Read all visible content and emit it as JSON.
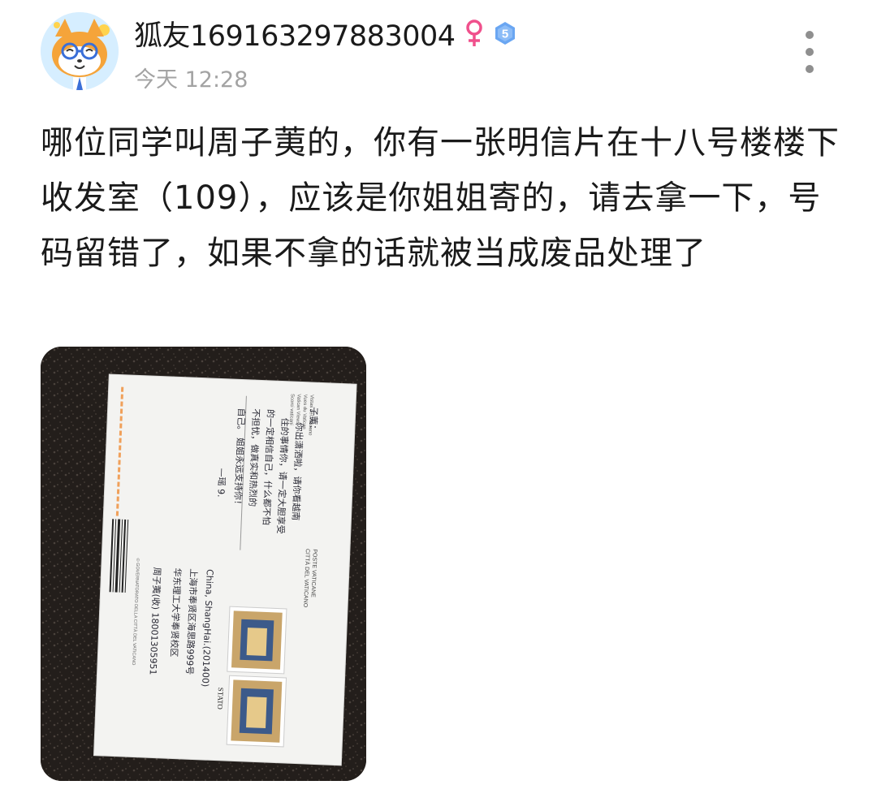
{
  "user": {
    "name": "狐友169163297883004",
    "gender": "female",
    "gender_symbol": "♀",
    "gender_color": "#f0508c",
    "level": "5",
    "level_color": "#6aa6f2"
  },
  "post": {
    "time": "今天 12:28",
    "text": "哪位同学叫周子荑的，你有一张明信片在十八号楼楼下收发室（109），应该是你姐姐寄的，请去拿一下，号码留错了，如果不拿的话就被当成废品处理了"
  },
  "photo": {
    "description_icon": "postcard-photo",
    "postcard": {
      "header_lines": [
        "Scorci vaticani",
        "Vatican Views",
        "Vues du Vatican",
        "Vistas del Vaticano"
      ],
      "handwritten_lines": [
        "子荑：",
        "你出潇洒啦，请你看越南",
        "住的事情你，请一定大胆享受",
        "的一定相信自己，什么都不怕",
        "不担忧，做真实和热烈的",
        "自己。 姐姐永远支持你！",
        "—瑶 9."
      ],
      "publisher": "© GOVERNATORATO DELLA CITTÀ DEL VATICANO",
      "postage": [
        "POSTE VATICANE",
        "CITTÀ DEL VATICANO"
      ],
      "stamp_label": "STATO",
      "address_lines": [
        "China, ShangHai.(201400)",
        "上海市奉贤区海思路999号",
        "华东理工大学奉贤校区",
        "周子荑(收) 18001305951"
      ]
    }
  }
}
